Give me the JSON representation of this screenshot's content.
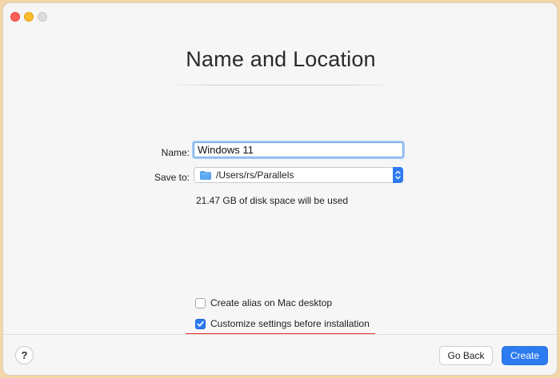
{
  "window": {
    "title": "Name and Location"
  },
  "form": {
    "name_label": "Name:",
    "name_value": "Windows 11",
    "save_label": "Save to:",
    "save_path": "/Users/rs/Parallels",
    "disk_info": "21.47 GB of disk space will be used"
  },
  "options": [
    {
      "label": "Create alias on Mac desktop",
      "checked": false
    },
    {
      "label": "Customize settings before installation",
      "checked": true
    }
  ],
  "footer": {
    "help_label": "?",
    "back_label": "Go Back",
    "create_label": "Create"
  },
  "colors": {
    "accent": "#2d7bf0",
    "annotation": "#e8312b"
  },
  "icons": {
    "folder": "folder-icon",
    "stepper": "chevron-up-down-icon",
    "check": "checkmark-icon"
  }
}
